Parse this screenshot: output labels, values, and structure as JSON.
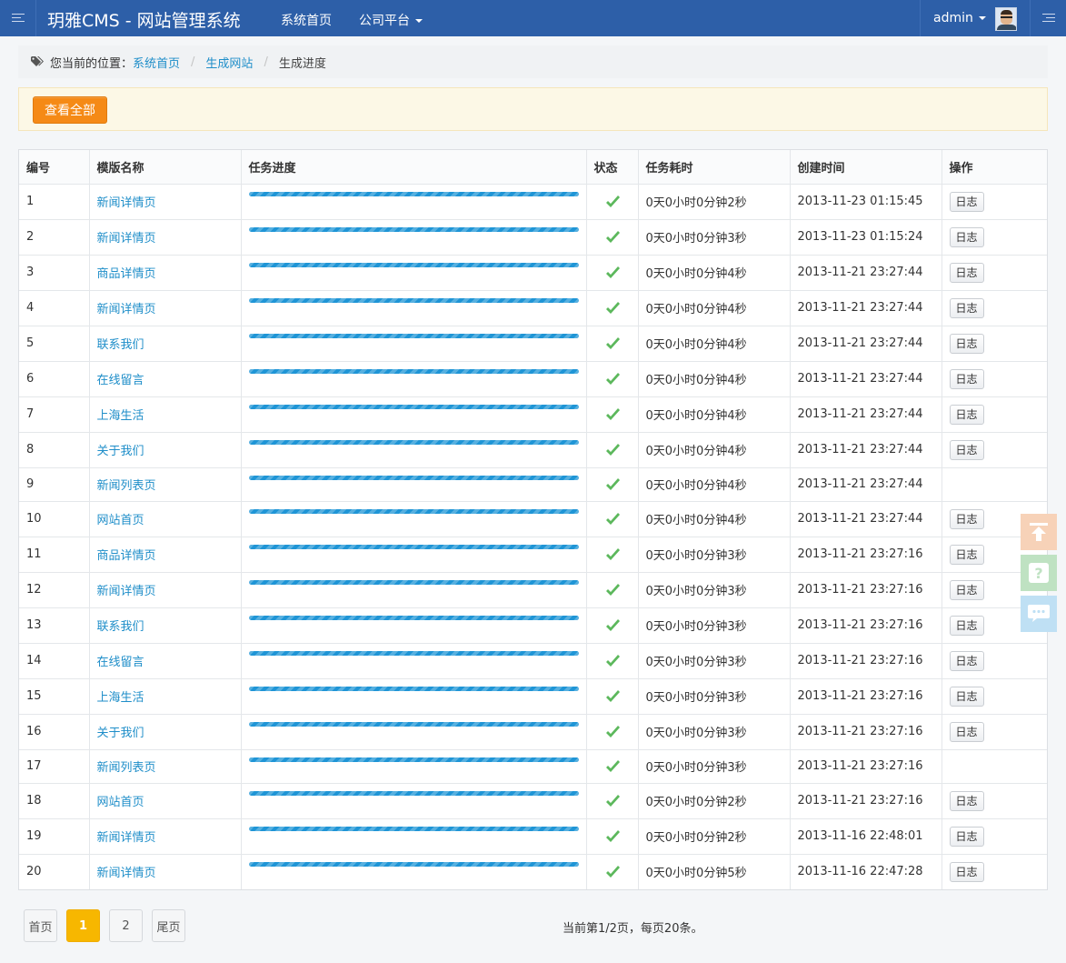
{
  "header": {
    "brand": "玥雅CMS - 网站管理系统",
    "nav": [
      {
        "label": "系统首页"
      },
      {
        "label": "公司平台"
      }
    ],
    "user": "admin"
  },
  "breadcrumb": {
    "prefix": "您当前的位置：",
    "items": [
      "系统首页",
      "生成网站"
    ],
    "current": "生成进度"
  },
  "toolbar": {
    "view_all_label": "查看全部"
  },
  "table": {
    "headers": [
      "编号",
      "模版名称",
      "任务进度",
      "状态",
      "任务耗时",
      "创建时间",
      "操作"
    ],
    "log_label": "日志",
    "progress_percent": 100,
    "rows": [
      {
        "id": "1",
        "name": "新闻详情页",
        "duration": "0天0小时0分钟2秒",
        "created": "2013-11-23 01:15:45",
        "has_log": true
      },
      {
        "id": "2",
        "name": "新闻详情页",
        "duration": "0天0小时0分钟3秒",
        "created": "2013-11-23 01:15:24",
        "has_log": true
      },
      {
        "id": "3",
        "name": "商品详情页",
        "duration": "0天0小时0分钟4秒",
        "created": "2013-11-21 23:27:44",
        "has_log": true
      },
      {
        "id": "4",
        "name": "新闻详情页",
        "duration": "0天0小时0分钟4秒",
        "created": "2013-11-21 23:27:44",
        "has_log": true
      },
      {
        "id": "5",
        "name": "联系我们",
        "duration": "0天0小时0分钟4秒",
        "created": "2013-11-21 23:27:44",
        "has_log": true
      },
      {
        "id": "6",
        "name": "在线留言",
        "duration": "0天0小时0分钟4秒",
        "created": "2013-11-21 23:27:44",
        "has_log": true
      },
      {
        "id": "7",
        "name": "上海生活",
        "duration": "0天0小时0分钟4秒",
        "created": "2013-11-21 23:27:44",
        "has_log": true
      },
      {
        "id": "8",
        "name": "关于我们",
        "duration": "0天0小时0分钟4秒",
        "created": "2013-11-21 23:27:44",
        "has_log": true
      },
      {
        "id": "9",
        "name": "新闻列表页",
        "duration": "0天0小时0分钟4秒",
        "created": "2013-11-21 23:27:44",
        "has_log": false
      },
      {
        "id": "10",
        "name": "网站首页",
        "duration": "0天0小时0分钟4秒",
        "created": "2013-11-21 23:27:44",
        "has_log": true
      },
      {
        "id": "11",
        "name": "商品详情页",
        "duration": "0天0小时0分钟3秒",
        "created": "2013-11-21 23:27:16",
        "has_log": true
      },
      {
        "id": "12",
        "name": "新闻详情页",
        "duration": "0天0小时0分钟3秒",
        "created": "2013-11-21 23:27:16",
        "has_log": true
      },
      {
        "id": "13",
        "name": "联系我们",
        "duration": "0天0小时0分钟3秒",
        "created": "2013-11-21 23:27:16",
        "has_log": true
      },
      {
        "id": "14",
        "name": "在线留言",
        "duration": "0天0小时0分钟3秒",
        "created": "2013-11-21 23:27:16",
        "has_log": true
      },
      {
        "id": "15",
        "name": "上海生活",
        "duration": "0天0小时0分钟3秒",
        "created": "2013-11-21 23:27:16",
        "has_log": true
      },
      {
        "id": "16",
        "name": "关于我们",
        "duration": "0天0小时0分钟3秒",
        "created": "2013-11-21 23:27:16",
        "has_log": true
      },
      {
        "id": "17",
        "name": "新闻列表页",
        "duration": "0天0小时0分钟3秒",
        "created": "2013-11-21 23:27:16",
        "has_log": false
      },
      {
        "id": "18",
        "name": "网站首页",
        "duration": "0天0小时0分钟2秒",
        "created": "2013-11-21 23:27:16",
        "has_log": true
      },
      {
        "id": "19",
        "name": "新闻详情页",
        "duration": "0天0小时0分钟2秒",
        "created": "2013-11-16 22:48:01",
        "has_log": true
      },
      {
        "id": "20",
        "name": "新闻详情页",
        "duration": "0天0小时0分钟5秒",
        "created": "2013-11-16 22:47:28",
        "has_log": true
      }
    ]
  },
  "pagination": {
    "first": "首页",
    "pages": [
      "1",
      "2"
    ],
    "current": "1",
    "last": "尾页",
    "info": "当前第1/2页，每页20条。"
  },
  "icons": {
    "tag": "tag-icon",
    "status": "check-icon",
    "float": [
      "back-to-top-icon",
      "help-icon",
      "chat-icon"
    ]
  },
  "colors": {
    "header_bg": "#2d5fa8",
    "link": "#1f8ec9",
    "progress": "#1f95d6",
    "check": "#5cb85c",
    "view_all_button": "#f58a16",
    "active_page": "#f7b700"
  }
}
